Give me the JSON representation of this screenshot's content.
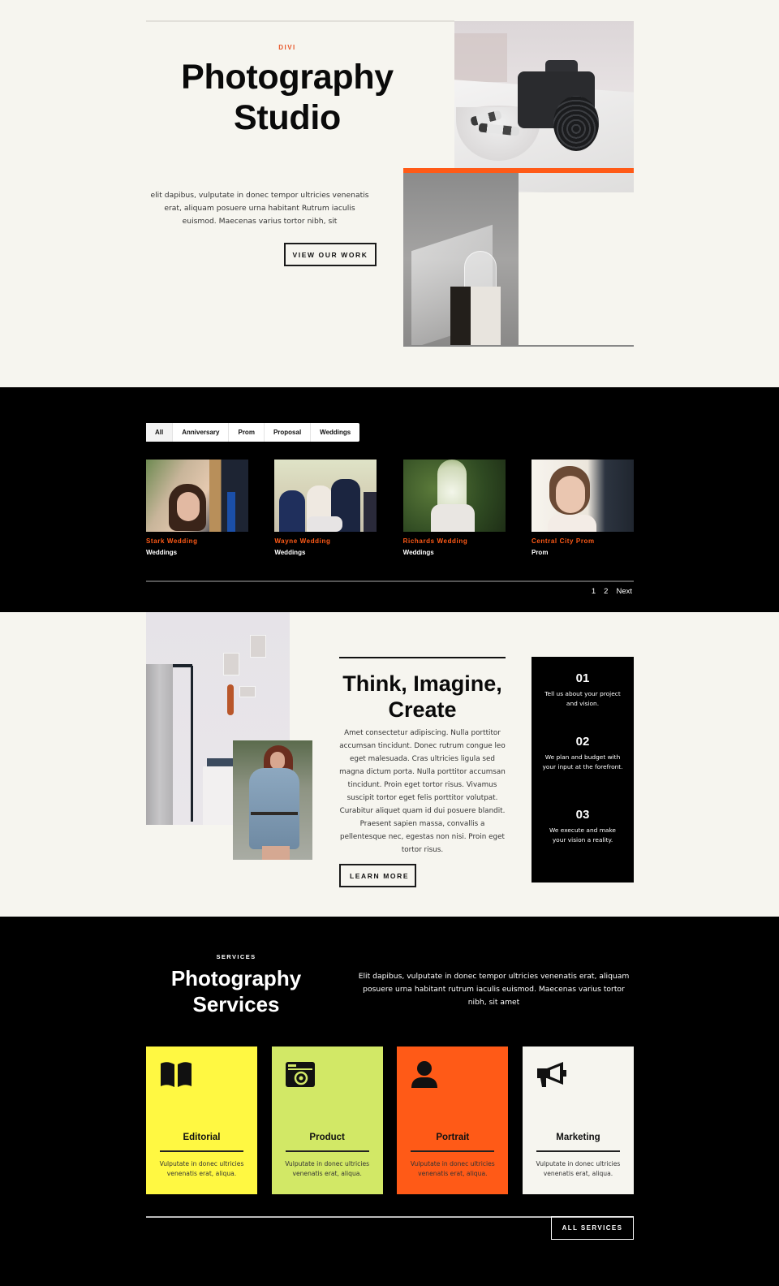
{
  "hero": {
    "eyebrow": "DIVI",
    "title_line1": "Photography",
    "title_line2": "Studio",
    "text": "elit dapibus, vulputate in donec tempor ultricies venenatis erat, aliquam posuere urna habitant Rutrum iaculis euismod. Maecenas varius tortor nibh, sit",
    "cta_label": "VIEW OUR WORK",
    "accent_color": "#ff5a17"
  },
  "portfolio": {
    "filters": [
      {
        "label": "All",
        "active": true
      },
      {
        "label": "Anniversary"
      },
      {
        "label": "Prom"
      },
      {
        "label": "Proposal"
      },
      {
        "label": "Weddings"
      }
    ],
    "items": [
      {
        "title": "Stark Wedding",
        "category": "Weddings"
      },
      {
        "title": "Wayne Wedding",
        "category": "Weddings"
      },
      {
        "title": "Richards Wedding",
        "category": "Weddings"
      },
      {
        "title": "Central City Prom",
        "category": "Prom"
      }
    ],
    "pagination": {
      "pages": [
        "1",
        "2"
      ],
      "next_label": "Next"
    }
  },
  "process": {
    "title_line1": "Think, Imagine,",
    "title_line2": "Create",
    "text": "Amet consectetur adipiscing. Nulla porttitor accumsan tincidunt. Donec rutrum congue leo eget malesuada. Cras ultricies ligula sed magna dictum porta. Nulla porttitor accumsan tincidunt. Proin eget tortor risus. Vivamus suscipit tortor eget felis porttitor volutpat. Curabitur aliquet quam id dui posuere blandit. Praesent sapien massa, convallis a pellentesque nec, egestas non nisi. Proin eget tortor risus.",
    "cta_label": "LEARN MORE",
    "steps": [
      {
        "number": "01",
        "text": "Tell us about your project and vision."
      },
      {
        "number": "02",
        "text": "We plan and budget with your input at the forefront."
      },
      {
        "number": "03",
        "text": "We execute and make your vision a reality."
      }
    ]
  },
  "services": {
    "eyebrow": "SERVICES",
    "title_line1": "Photography",
    "title_line2": "Services",
    "text": "Elit dapibus, vulputate in donec tempor ultricies venenatis erat, aliquam posuere urna habitant rutrum iaculis euismod. Maecenas varius tortor nibh, sit amet",
    "cards": [
      {
        "name": "Editorial",
        "icon": "book-icon",
        "description": "Vulputate in donec ultricies venenatis erat, aliqua.",
        "color": "#fff842"
      },
      {
        "name": "Product",
        "icon": "camera-icon",
        "description": "Vulputate in donec ultricies venenatis erat, aliqua.",
        "color": "#d2e866"
      },
      {
        "name": "Portrait",
        "icon": "user-icon",
        "description": "Vulputate in donec ultricies venenatis erat, aliqua.",
        "color": "#ff5a17"
      },
      {
        "name": "Marketing",
        "icon": "megaphone-icon",
        "description": "Vulputate in donec ultricies venenatis erat, aliqua.",
        "color": "#f6f5ef"
      }
    ],
    "cta_label": "ALL SERVICES"
  }
}
